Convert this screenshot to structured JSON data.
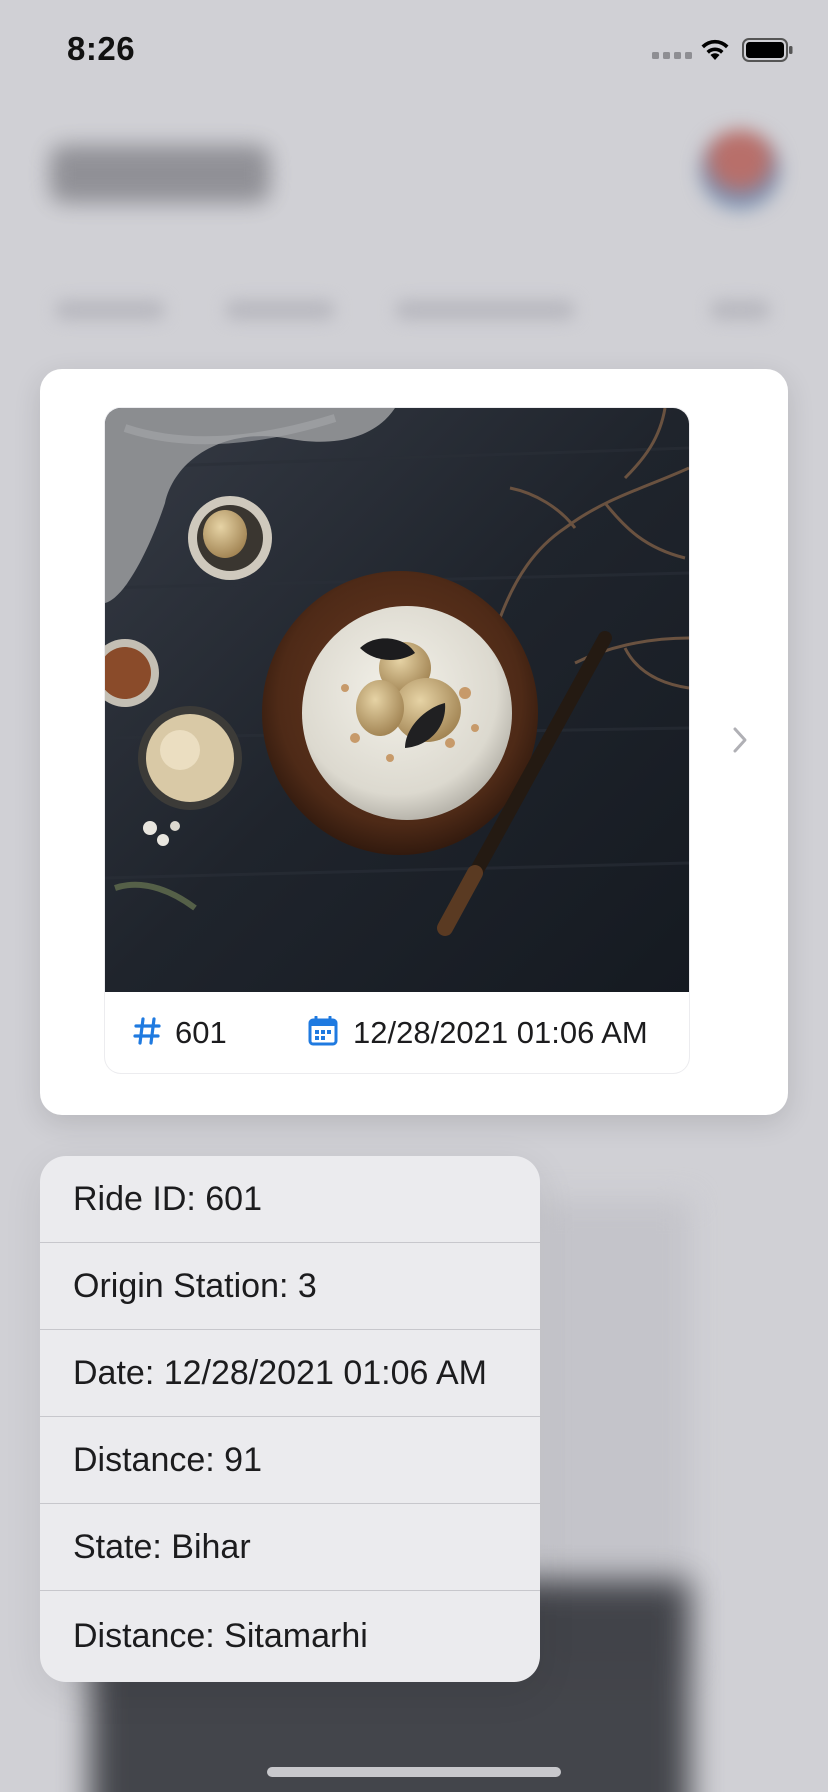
{
  "status_bar": {
    "time": "8:26"
  },
  "preview": {
    "ride_id": "601",
    "datetime": "12/28/2021 01:06 AM",
    "accent_color": "#1f7ae0"
  },
  "menu": {
    "items": [
      {
        "label": "Ride ID: 601"
      },
      {
        "label": "Origin Station: 3"
      },
      {
        "label": "Date: 12/28/2021 01:06 AM"
      },
      {
        "label": "Distance: 91"
      },
      {
        "label": "State: Bihar"
      },
      {
        "label": "Distance: Sitamarhi"
      }
    ]
  }
}
